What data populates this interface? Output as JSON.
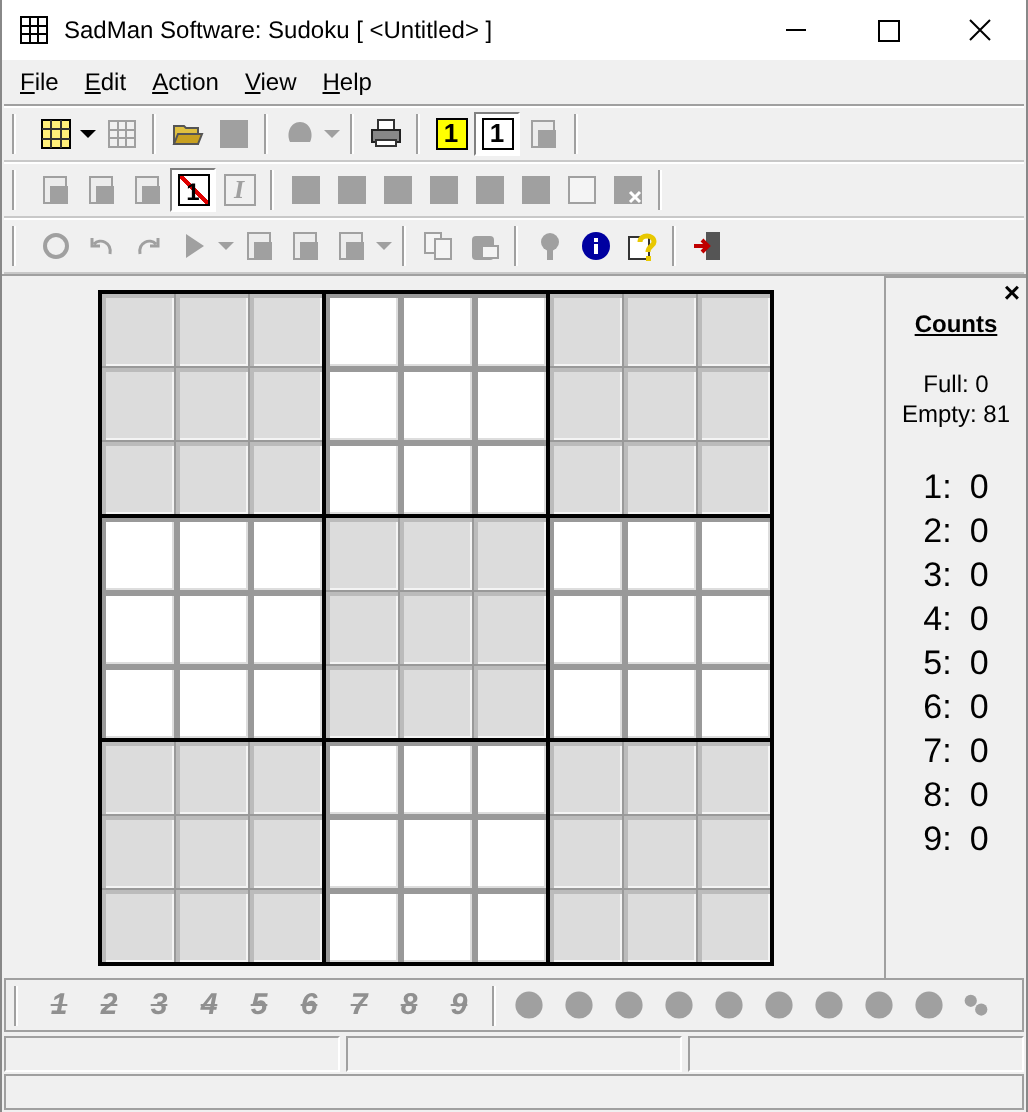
{
  "window": {
    "title": "SadMan Software: Sudoku [ <Untitled> ]"
  },
  "menu": [
    "File",
    "Edit",
    "Action",
    "View",
    "Help"
  ],
  "toolbars": [
    [
      {
        "kind": "board",
        "disabled": false,
        "pressed": false
      },
      {
        "kind": "caret",
        "disabled": false
      },
      {
        "kind": "grid",
        "disabled": true,
        "pressed": false
      },
      {
        "kind": "separator"
      },
      {
        "kind": "folder",
        "disabled": false,
        "pressed": false
      },
      {
        "kind": "square",
        "disabled": true,
        "pressed": false
      },
      {
        "kind": "separator"
      },
      {
        "kind": "blob",
        "disabled": true,
        "pressed": false
      },
      {
        "kind": "caret",
        "disabled": true
      },
      {
        "kind": "separator"
      },
      {
        "kind": "printer",
        "disabled": false,
        "pressed": false
      },
      {
        "kind": "separator"
      },
      {
        "kind": "digit",
        "label": "1",
        "color": "#ffff00",
        "disabled": false,
        "pressed": false
      },
      {
        "kind": "digit",
        "label": "1",
        "color": "#ffffff",
        "disabled": false,
        "pressed": true
      },
      {
        "kind": "pages",
        "disabled": true,
        "pressed": false
      },
      {
        "kind": "separator"
      }
    ],
    [
      {
        "kind": "pages",
        "disabled": true,
        "pressed": false
      },
      {
        "kind": "pages",
        "disabled": true,
        "pressed": false
      },
      {
        "kind": "pages",
        "disabled": true,
        "pressed": false
      },
      {
        "kind": "nodigit",
        "label": "1",
        "disabled": false,
        "pressed": true
      },
      {
        "kind": "italic",
        "label": "I",
        "disabled": true,
        "pressed": false
      },
      {
        "kind": "separator"
      },
      {
        "kind": "square",
        "disabled": true,
        "pressed": false
      },
      {
        "kind": "square",
        "disabled": true,
        "pressed": false
      },
      {
        "kind": "square",
        "disabled": true,
        "pressed": false
      },
      {
        "kind": "square",
        "disabled": true,
        "pressed": false
      },
      {
        "kind": "square",
        "disabled": true,
        "pressed": false
      },
      {
        "kind": "square",
        "disabled": true,
        "pressed": false
      },
      {
        "kind": "blank",
        "disabled": true,
        "pressed": false
      },
      {
        "kind": "squarex",
        "disabled": true,
        "pressed": false
      },
      {
        "kind": "separator"
      }
    ],
    [
      {
        "kind": "cycle",
        "disabled": true,
        "pressed": false
      },
      {
        "kind": "undo",
        "disabled": true,
        "pressed": false
      },
      {
        "kind": "redo",
        "disabled": true,
        "pressed": false
      },
      {
        "kind": "play",
        "disabled": true,
        "pressed": false
      },
      {
        "kind": "caret",
        "disabled": true
      },
      {
        "kind": "pages",
        "disabled": true,
        "pressed": false
      },
      {
        "kind": "pages",
        "disabled": true,
        "pressed": false
      },
      {
        "kind": "pages",
        "disabled": true,
        "pressed": false
      },
      {
        "kind": "caret",
        "disabled": true
      },
      {
        "kind": "separator"
      },
      {
        "kind": "copy",
        "disabled": true,
        "pressed": false
      },
      {
        "kind": "paste",
        "disabled": true,
        "pressed": false
      },
      {
        "kind": "separator"
      },
      {
        "kind": "bulb",
        "disabled": true,
        "pressed": false
      },
      {
        "kind": "info",
        "disabled": false,
        "pressed": false
      },
      {
        "kind": "help",
        "disabled": false,
        "pressed": false
      },
      {
        "kind": "separator"
      },
      {
        "kind": "exit",
        "disabled": false,
        "pressed": false
      }
    ]
  ],
  "board": {
    "boxes": [
      {
        "shaded": true
      },
      {
        "shaded": false
      },
      {
        "shaded": true
      },
      {
        "shaded": false
      },
      {
        "shaded": true
      },
      {
        "shaded": false
      },
      {
        "shaded": true
      },
      {
        "shaded": false
      },
      {
        "shaded": true
      }
    ]
  },
  "counts_panel": {
    "close": "×",
    "title": "Counts",
    "full": "Full: 0",
    "empty": "Empty: 81",
    "digits": [
      {
        "digit": "1:",
        "count": "0"
      },
      {
        "digit": "2:",
        "count": "0"
      },
      {
        "digit": "3:",
        "count": "0"
      },
      {
        "digit": "4:",
        "count": "0"
      },
      {
        "digit": "5:",
        "count": "0"
      },
      {
        "digit": "6:",
        "count": "0"
      },
      {
        "digit": "7:",
        "count": "0"
      },
      {
        "digit": "8:",
        "count": "0"
      },
      {
        "digit": "9:",
        "count": "0"
      }
    ]
  },
  "digit_toolbar": [
    {
      "label": "1",
      "disabled": true
    },
    {
      "label": "2",
      "disabled": true
    },
    {
      "label": "3",
      "disabled": true
    },
    {
      "label": "4",
      "disabled": true
    },
    {
      "label": "5",
      "disabled": true
    },
    {
      "label": "6",
      "disabled": true
    },
    {
      "label": "7",
      "disabled": true
    },
    {
      "label": "8",
      "disabled": true
    },
    {
      "label": "9",
      "disabled": true
    }
  ]
}
